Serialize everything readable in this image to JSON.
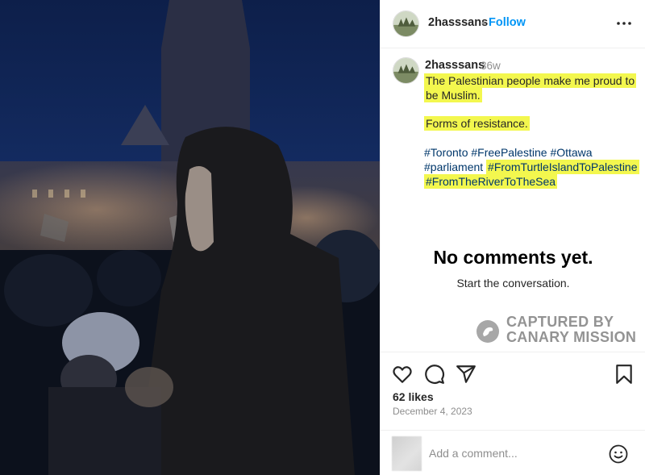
{
  "post": {
    "username": "2hasssans",
    "dot": "•",
    "follow_label": "Follow",
    "more_icon": "more-horizontal-icon",
    "caption": {
      "username": "2hasssans",
      "time": "36w",
      "line1": "The Palestinian people make me proud to",
      "line2": "be Muslim.",
      "line3": "Forms of resistance.",
      "tags_row1": [
        "#Toronto",
        "#FreePalestine",
        "#Ottawa"
      ],
      "tags_row2a": "#parliament",
      "tags_row2b": "#FromTurtleIslandToPalestine",
      "tags_row3": "#FromTheRiverToTheSea"
    },
    "no_comments_title": "No comments yet.",
    "no_comments_sub": "Start the conversation.",
    "watermark": {
      "line1": "CAPTURED BY",
      "line2": "CANARY MISSION"
    },
    "actions": {
      "like_icon": "heart-icon",
      "comment_icon": "comment-bubble-icon",
      "share_icon": "paper-plane-icon",
      "save_icon": "bookmark-icon"
    },
    "likes": "62 likes",
    "date": "December 4, 2023",
    "comment_placeholder": "Add a comment...",
    "emoji_icon": "smiley-icon"
  },
  "colors": {
    "link": "#0095f6",
    "highlight": "#f3f74e",
    "hashtag": "#00376b"
  }
}
